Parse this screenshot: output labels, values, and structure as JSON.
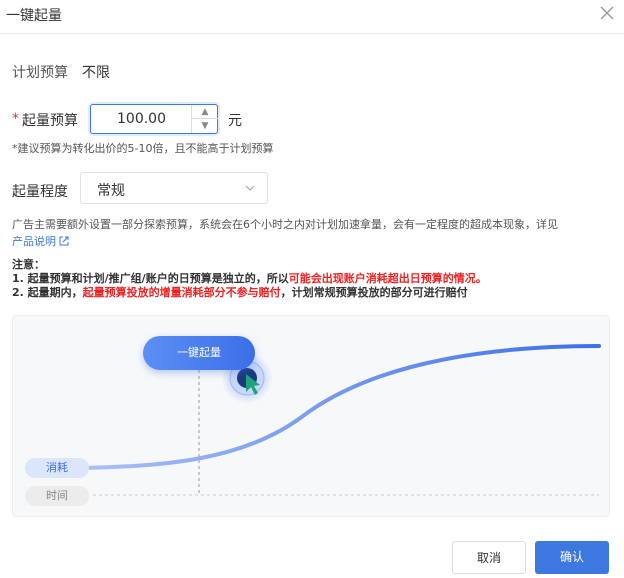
{
  "dialog": {
    "title": "一键起量"
  },
  "plan_budget": {
    "label": "计划预算",
    "value": "不限"
  },
  "start_budget": {
    "required_mark": "*",
    "label": "起量预算",
    "value": "100.00",
    "unit": "元",
    "hint": "*建议预算为转化出价的5-10倍，且不能高于计划预算"
  },
  "level": {
    "label": "起量程度",
    "selected": "常规"
  },
  "description": "广告主需要额外设置一部分探索预算，系统会在6个小时之内对计划加速拿量，会有一定程度的超成本现象，详见",
  "link_text": "产品说明",
  "notice": {
    "title": "注意：",
    "line1_prefix": "1. 起量预算和计划/推广组/账户的日预算是独立的，所以",
    "line1_red": "可能会出现账户消耗超出日预算的情况。",
    "line2_prefix": "2. 起量期内，",
    "line2_red": "起量预算投放的增量消耗部分不参与赔付",
    "line2_suffix": "，计划常规预算投放的部分可进行赔付"
  },
  "illustration": {
    "button_label": "一键起量",
    "cost_label": "消耗",
    "time_label": "时间"
  },
  "footer": {
    "cancel_label": "取消",
    "ok_label": "确认"
  },
  "colors": {
    "accent": "#3c78e0",
    "warning": "#e22222"
  }
}
